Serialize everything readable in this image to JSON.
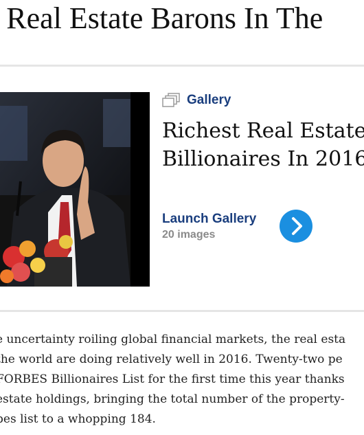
{
  "article": {
    "headline": "t Real Estate Barons In The"
  },
  "gallery": {
    "tag_label": "Gallery",
    "title": "Richest Real Estate Billionaires In 2016",
    "launch_label": "Launch Gallery",
    "image_count": "20 images",
    "photo_icon": "gallery-stack-icon",
    "button_icon": "chevron-right-icon"
  },
  "body": {
    "lines": [
      "e uncertainty roiling global financial markets, the real esta",
      "the world are doing relatively well in 2016. Twenty-two pe",
      "FORBES Billionaires List for the first time this year thanks",
      "estate holdings, bringing the total number of the property-",
      "bes list to a whopping 184."
    ]
  },
  "colors": {
    "link_blue": "#1a3e7e",
    "button_blue": "#1b8fe0",
    "meta_gray": "#8a8a8a",
    "divider": "#e5e5e5"
  }
}
